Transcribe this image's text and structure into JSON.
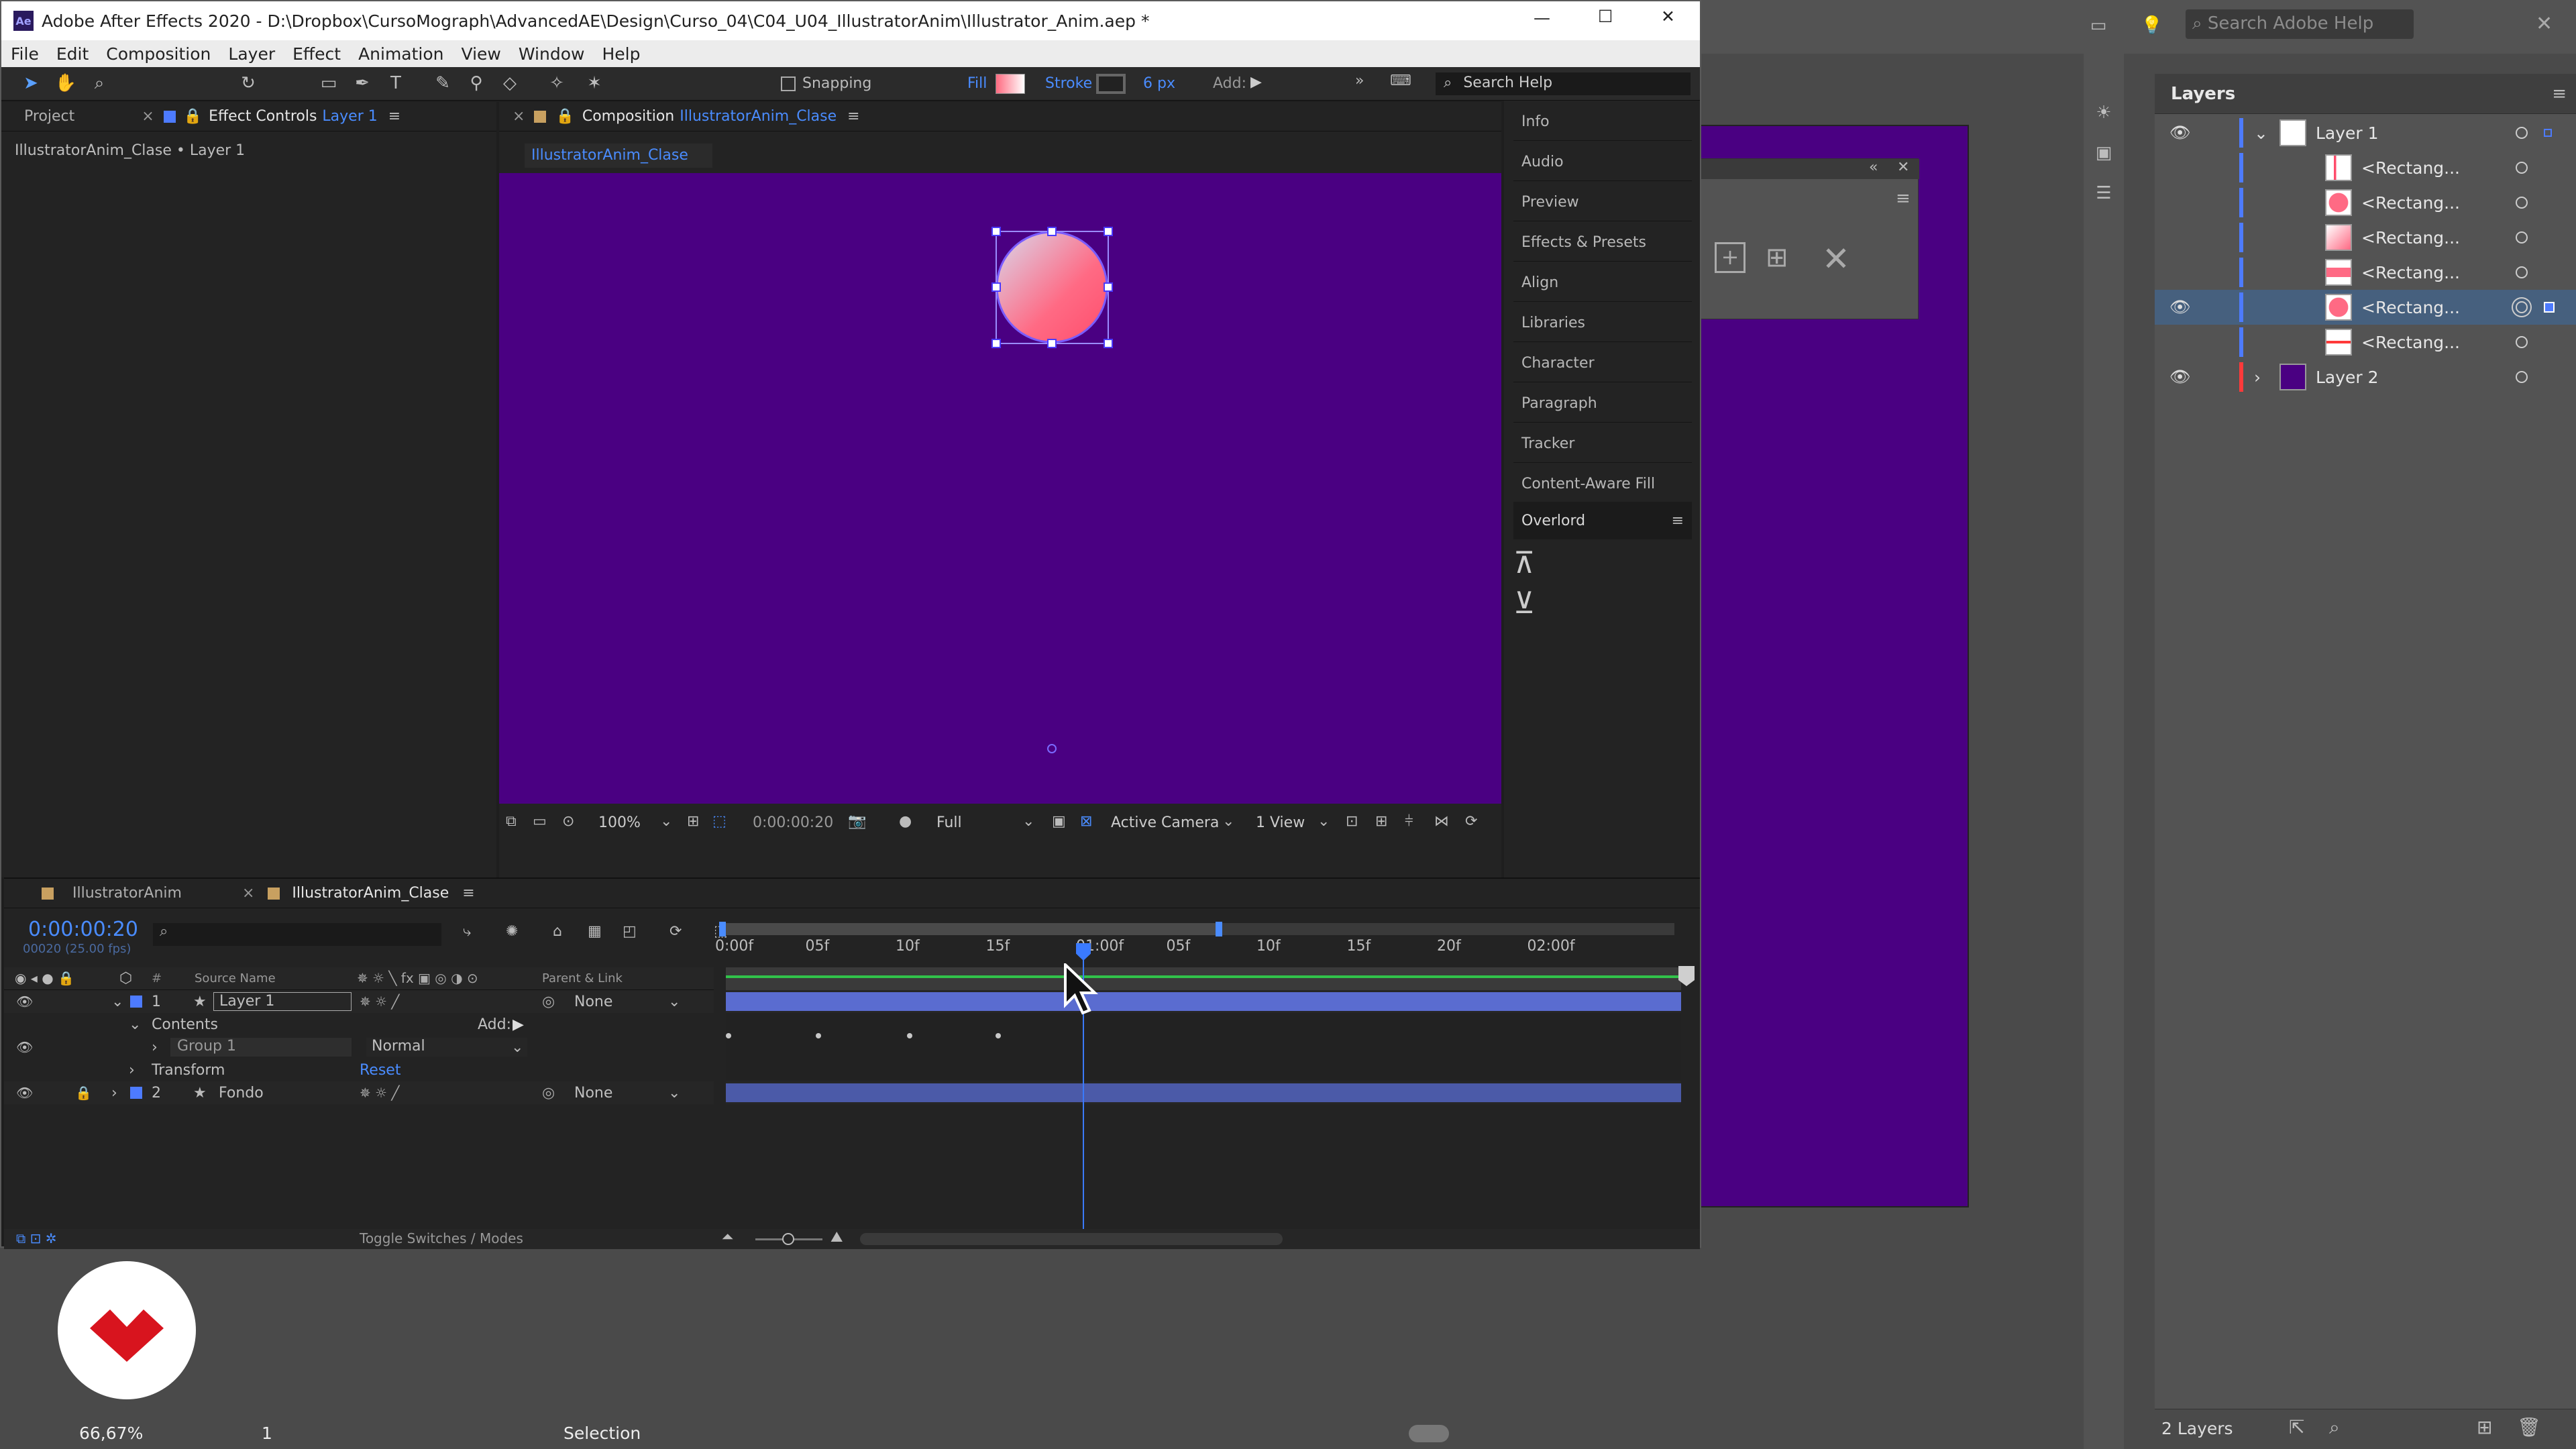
{
  "illustrator": {
    "search_placeholder": "Search Adobe Help",
    "zoom": "66,67%",
    "page": "1",
    "status_tool": "Selection",
    "layers_panel": {
      "title": "Layers",
      "rows": [
        {
          "name": "Layer 1",
          "indent": 0,
          "expanded": true,
          "visible": true,
          "color": "#4d7bff",
          "thumb": "white",
          "selected": false
        },
        {
          "name": "<Rectang...",
          "indent": 1,
          "visible": false,
          "color": "#4d7bff",
          "thumb": "gradient-bar",
          "selected": false
        },
        {
          "name": "<Rectang...",
          "indent": 1,
          "visible": false,
          "color": "#4d7bff",
          "thumb": "circle",
          "selected": false
        },
        {
          "name": "<Rectang...",
          "indent": 1,
          "visible": false,
          "color": "#4d7bff",
          "thumb": "pink",
          "selected": false
        },
        {
          "name": "<Rectang...",
          "indent": 1,
          "visible": false,
          "color": "#4d7bff",
          "thumb": "pink-small",
          "selected": false
        },
        {
          "name": "<Rectang...",
          "indent": 1,
          "visible": true,
          "color": "#4d7bff",
          "thumb": "circle",
          "selected": true
        },
        {
          "name": "<Rectang...",
          "indent": 1,
          "visible": false,
          "color": "#4d7bff",
          "thumb": "red-line",
          "selected": false
        },
        {
          "name": "Layer 2",
          "indent": 0,
          "expanded": false,
          "visible": true,
          "color": "#ff3a3a",
          "thumb": "purple",
          "selected": false
        }
      ],
      "footer_count": "2 Layers"
    }
  },
  "after_effects": {
    "title": "Adobe After Effects 2020 - D:\\Dropbox\\CursoMograph\\AdvancedAE\\Design\\Curso_04\\C04_U04_IllustratorAnim\\Illustrator_Anim.aep *",
    "menu": [
      "File",
      "Edit",
      "Composition",
      "Layer",
      "Effect",
      "Animation",
      "View",
      "Window",
      "Help"
    ],
    "toolbar": {
      "snapping": "Snapping",
      "fill": "Fill",
      "stroke": "Stroke",
      "stroke_width": "6 px",
      "add": "Add:",
      "search": "Search Help"
    },
    "left_panel": {
      "tab_project": "Project",
      "tab_effect_controls": "Effect Controls",
      "tab_effect_controls_layer": "Layer 1",
      "breadcrumb": "IllustratorAnim_Clase • Layer 1"
    },
    "comp_panel": {
      "tab_label": "Composition",
      "tab_comp_name": "IllustratorAnim_Clase",
      "sub_tab": "IllustratorAnim_Clase",
      "zoom": "100%",
      "timecode": "0:00:00:20",
      "resolution": "Full",
      "camera": "Active Camera",
      "view": "1 View"
    },
    "right_panel": {
      "items": [
        "Info",
        "Audio",
        "Preview",
        "Effects & Presets",
        "Align",
        "Libraries",
        "Character",
        "Paragraph",
        "Tracker",
        "Content-Aware Fill"
      ],
      "overlord": "Overlord"
    },
    "timeline": {
      "tabs": [
        "IllustratorAnim",
        "IllustratorAnim_Clase"
      ],
      "timecode": "0:00:00:20",
      "fps": "00020 (25.00 fps)",
      "col_source": "Source Name",
      "col_parent": "Parent & Link",
      "ruler": [
        "0:00f",
        "05f",
        "10f",
        "15f",
        "01:00f",
        "05f",
        "10f",
        "15f",
        "20f",
        "02:00f"
      ],
      "rows": [
        {
          "num": "1",
          "name": "Layer 1",
          "parent": "None"
        },
        {
          "label": "Contents",
          "add": "Add:"
        },
        {
          "label": "Group 1",
          "mode": "Normal"
        },
        {
          "label": "Transform",
          "reset": "Reset"
        },
        {
          "num": "2",
          "name": "Fondo",
          "parent": "None"
        }
      ],
      "footer": "Toggle Switches / Modes"
    }
  }
}
